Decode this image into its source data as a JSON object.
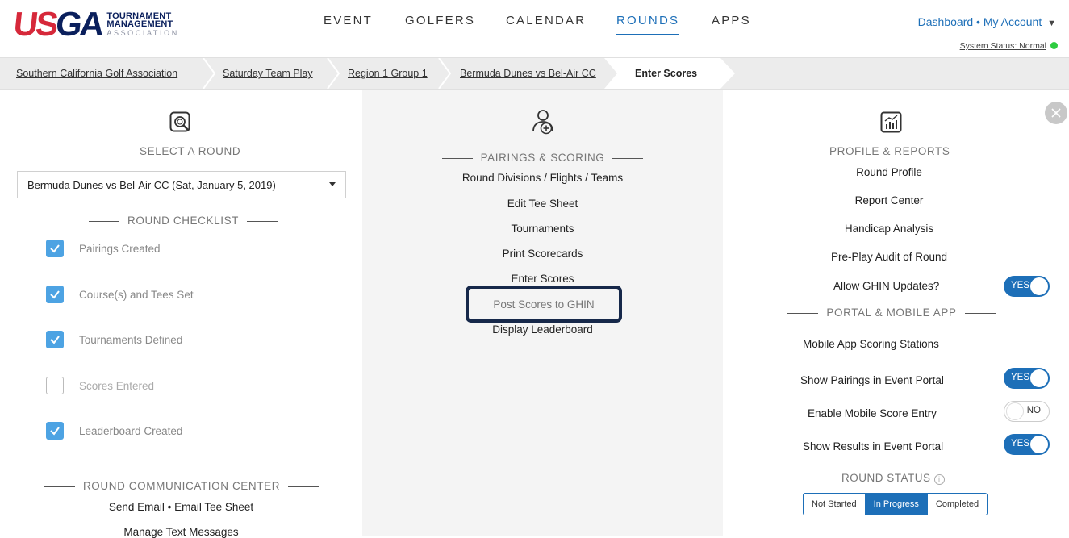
{
  "brand": {
    "logo_mark": "USGA",
    "line1": "TOURNAMENT",
    "line2": "MANAGEMENT",
    "line3": "ASSOCIATION",
    "colors": {
      "red": "#d6283a",
      "navy": "#0a1f5c",
      "accent": "#1d6fb8"
    }
  },
  "nav": {
    "items": [
      "EVENT",
      "GOLFERS",
      "CALENDAR",
      "ROUNDS",
      "APPS"
    ],
    "active": "ROUNDS"
  },
  "account": {
    "dashboard": "Dashboard",
    "separator": "•",
    "my_account": "My Account",
    "system_status": "System Status: Normal"
  },
  "breadcrumb": {
    "items": [
      "Southern California Golf Association",
      "Saturday Team Play",
      "Region 1 Group 1",
      "Bermuda Dunes vs Bel-Air CC"
    ],
    "current": "Enter Scores"
  },
  "left": {
    "select_heading": "SELECT A ROUND",
    "selected_round": "Bermuda Dunes vs Bel-Air CC (Sat, January 5, 2019)",
    "checklist_heading": "ROUND CHECKLIST",
    "checklist": [
      {
        "label": "Pairings Created",
        "checked": true
      },
      {
        "label": "Course(s) and Tees Set",
        "checked": true
      },
      {
        "label": "Tournaments Defined",
        "checked": true
      },
      {
        "label": "Scores Entered",
        "checked": false
      },
      {
        "label": "Leaderboard Created",
        "checked": true
      }
    ],
    "comm_heading": "ROUND COMMUNICATION CENTER",
    "send_email": "Send Email",
    "email_sep": "•",
    "email_tee_sheet": "Email Tee Sheet",
    "manage_text": "Manage Text Messages"
  },
  "middle": {
    "heading": "PAIRINGS & SCORING",
    "links": [
      "Round Divisions / Flights / Teams",
      "Edit Tee Sheet",
      "Tournaments",
      "Print Scorecards",
      "Enter Scores"
    ],
    "post_scores": "Post Scores to GHIN",
    "display_leaderboard": "Display Leaderboard"
  },
  "right": {
    "profile_heading": "PROFILE & REPORTS",
    "links": [
      "Round Profile",
      "Report Center",
      "Handicap Analysis",
      "Pre-Play Audit of Round"
    ],
    "allow_ghin": "Allow GHIN Updates?",
    "allow_ghin_value": "YES",
    "portal_heading": "PORTAL & MOBILE APP",
    "mobile_stations": "Mobile App Scoring Stations",
    "show_pairings": "Show Pairings in Event Portal",
    "show_pairings_value": "YES",
    "enable_mobile": "Enable Mobile Score Entry",
    "enable_mobile_value": "NO",
    "show_results": "Show Results in Event Portal",
    "show_results_value": "YES",
    "status_heading": "ROUND STATUS",
    "status_options": [
      "Not Started",
      "In Progress",
      "Completed"
    ],
    "status_active": "In Progress"
  }
}
